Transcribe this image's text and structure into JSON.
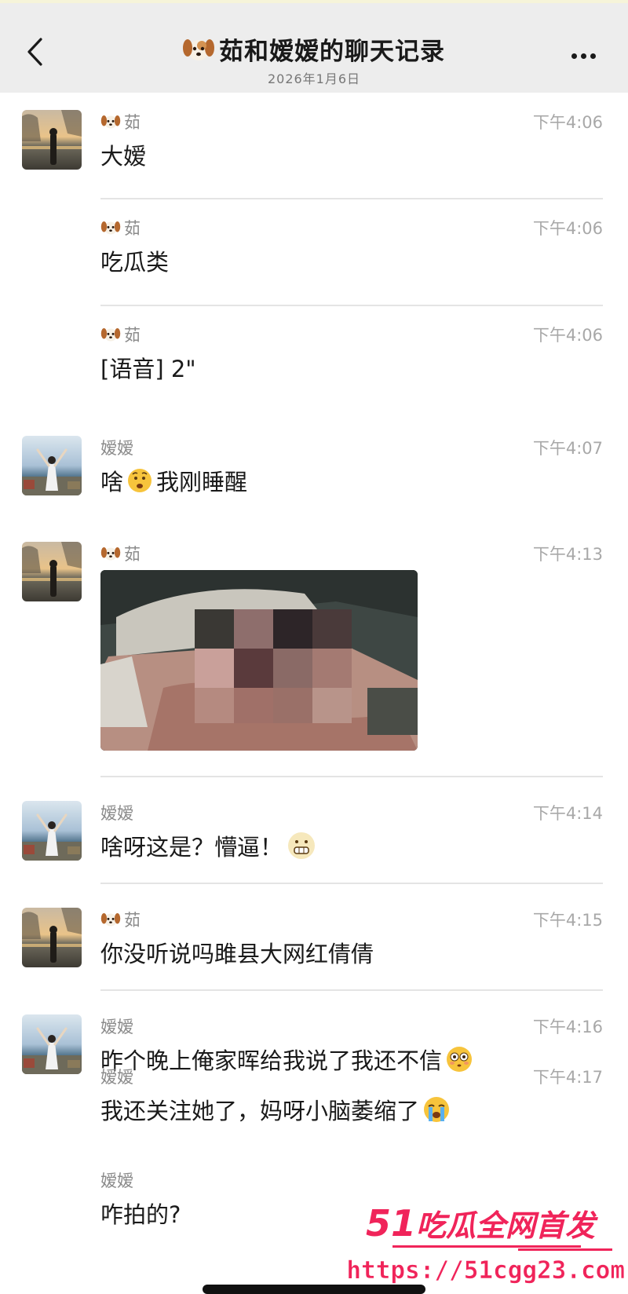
{
  "header": {
    "title": "茹和嫒嫒的聊天记录",
    "date": "2026年1月6日",
    "title_icon": "dog-emoji-icon",
    "background": "#ededed"
  },
  "senders": {
    "ru": "茹",
    "yuan": "嫒嫒"
  },
  "messages": [
    {
      "sender": "茹",
      "time": "下午4:06",
      "text": "大嫒"
    },
    {
      "sender": "茹",
      "time": "下午4:06",
      "text": "吃瓜类"
    },
    {
      "sender": "茹",
      "time": "下午4:06",
      "text": "[语音] 2\""
    },
    {
      "sender": "嫒嫒",
      "time": "下午4:07",
      "text_before": "啥",
      "text_after": "我刚睡醒",
      "emoji": "worried-face-emoji"
    },
    {
      "sender": "茹",
      "time": "下午4:13",
      "image": "blurred-bedroom-photo"
    },
    {
      "sender": "嫒嫒",
      "time": "下午4:14",
      "text": "啥呀这是？懵逼！",
      "emoji": "grimacing-face-emoji"
    },
    {
      "sender": "茹",
      "time": "下午4:15",
      "text": "你没听说吗雎县大网红倩倩"
    },
    {
      "sender": "嫒嫒",
      "time": "下午4:16",
      "text": "昨个晚上俺家晖给我说了我还不信",
      "emoji": "flushed-face-emoji"
    },
    {
      "sender": "嫒嫒",
      "time": "下午4:17",
      "text": "我还关注她了，妈呀小脑萎缩了",
      "emoji": "crying-face-emoji"
    },
    {
      "sender": "嫒嫒",
      "time": "",
      "text": "咋拍的?"
    }
  ],
  "watermark": {
    "brand_num": "51",
    "brand_text": "吃瓜全网首发",
    "url": "https://51cgg23.com",
    "color": "#f0245a"
  }
}
